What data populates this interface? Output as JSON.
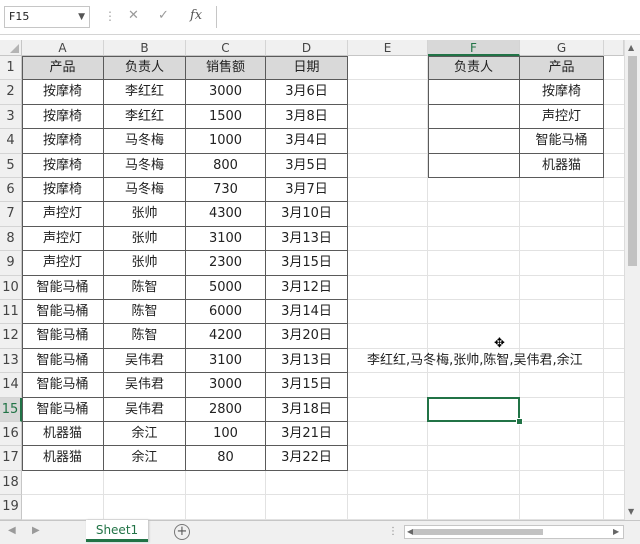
{
  "formula_bar": {
    "name_box": "F15",
    "cancel_icon": "✕",
    "enter_icon": "✓",
    "fx_icon": "fx",
    "formula": ""
  },
  "columns": [
    "A",
    "B",
    "C",
    "D",
    "E",
    "F",
    "G"
  ],
  "rows": [
    "1",
    "2",
    "3",
    "4",
    "5",
    "6",
    "7",
    "8",
    "9",
    "10",
    "11",
    "12",
    "13",
    "14",
    "15",
    "16",
    "17",
    "18",
    "19"
  ],
  "selected": {
    "column": "F",
    "row": "15"
  },
  "table1": {
    "headers": [
      "产品",
      "负责人",
      "销售额",
      "日期"
    ],
    "rows": [
      [
        "按摩椅",
        "李红红",
        "3000",
        "3月6日"
      ],
      [
        "按摩椅",
        "李红红",
        "1500",
        "3月8日"
      ],
      [
        "按摩椅",
        "马冬梅",
        "1000",
        "3月4日"
      ],
      [
        "按摩椅",
        "马冬梅",
        "800",
        "3月5日"
      ],
      [
        "按摩椅",
        "马冬梅",
        "730",
        "3月7日"
      ],
      [
        "声控灯",
        "张帅",
        "4300",
        "3月10日"
      ],
      [
        "声控灯",
        "张帅",
        "3100",
        "3月13日"
      ],
      [
        "声控灯",
        "张帅",
        "2300",
        "3月15日"
      ],
      [
        "智能马桶",
        "陈智",
        "5000",
        "3月12日"
      ],
      [
        "智能马桶",
        "陈智",
        "6000",
        "3月14日"
      ],
      [
        "智能马桶",
        "陈智",
        "4200",
        "3月20日"
      ],
      [
        "智能马桶",
        "吴伟君",
        "3100",
        "3月13日"
      ],
      [
        "智能马桶",
        "吴伟君",
        "3000",
        "3月15日"
      ],
      [
        "智能马桶",
        "吴伟君",
        "2800",
        "3月18日"
      ],
      [
        "机器猫",
        "余江",
        "100",
        "3月21日"
      ],
      [
        "机器猫",
        "余江",
        "80",
        "3月22日"
      ]
    ]
  },
  "table2": {
    "headers": [
      "负责人",
      "产品"
    ],
    "rows": [
      [
        "",
        "按摩椅"
      ],
      [
        "",
        "声控灯"
      ],
      [
        "",
        "智能马桶"
      ],
      [
        "",
        "机器猫"
      ]
    ]
  },
  "result_text": "李红红,马冬梅,张帅,陈智,吴伟君,余江",
  "sheet_tab": "Sheet1",
  "add_sheet_icon": "+"
}
